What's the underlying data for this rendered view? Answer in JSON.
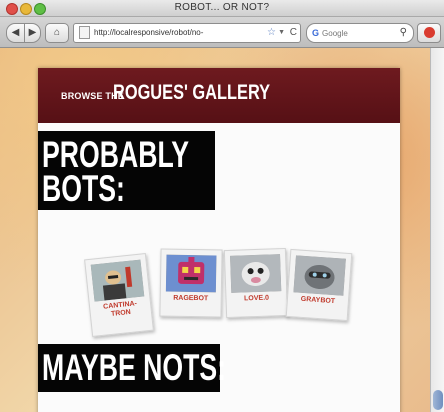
{
  "window": {
    "title": "ROBOT... OR NOT?"
  },
  "toolbar": {
    "url": "http://localresponsive/robot/no-",
    "search_placeholder": "Google"
  },
  "banner": {
    "small": "BROWSE THE",
    "big": "ROGUES' GALLERY"
  },
  "sections": {
    "probably": {
      "line1": "PROBABLY",
      "line2": "BOTS:"
    },
    "maybe": {
      "line1": "MAYBE NOTS:"
    }
  },
  "cards": [
    {
      "name_line1": "CANTINA-",
      "name_line2": "TRON"
    },
    {
      "name_line1": "RAGEBOT"
    },
    {
      "name_line1": "LOVE.0"
    },
    {
      "name_line1": "GRAYBOT"
    }
  ],
  "colors": {
    "banner": "#6e1a1f",
    "heading_bg": "#050505",
    "card_label": "#c0392b"
  }
}
